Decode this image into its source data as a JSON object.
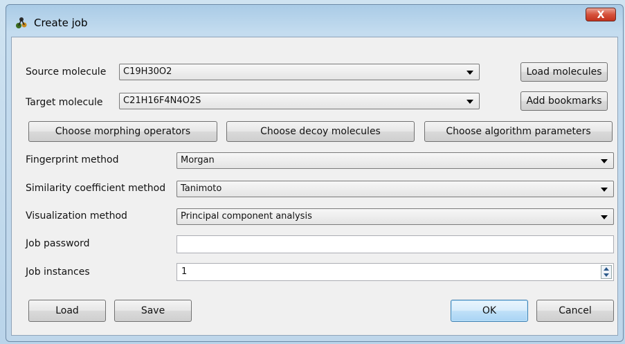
{
  "window": {
    "title": "Create job",
    "close_label": "X",
    "app_icon": "molecule-app-icon"
  },
  "source": {
    "label": "Source molecule",
    "value": "C19H30O2",
    "button": "Load molecules"
  },
  "target": {
    "label": "Target molecule",
    "value": "C21H16F4N4O2S",
    "button": "Add bookmarks"
  },
  "choose_buttons": {
    "morphing": "Choose morphing operators",
    "decoy": "Choose decoy molecules",
    "algorithm": "Choose algorithm parameters"
  },
  "fingerprint": {
    "label": "Fingerprint method",
    "value": "Morgan"
  },
  "similarity": {
    "label": "Similarity coefficient method",
    "value": "Tanimoto"
  },
  "visualization": {
    "label": "Visualization method",
    "value": "Principal component analysis"
  },
  "password": {
    "label": "Job password",
    "value": ""
  },
  "instances": {
    "label": "Job instances",
    "value": "1"
  },
  "footer": {
    "load": "Load",
    "save": "Save",
    "ok": "OK",
    "cancel": "Cancel"
  }
}
